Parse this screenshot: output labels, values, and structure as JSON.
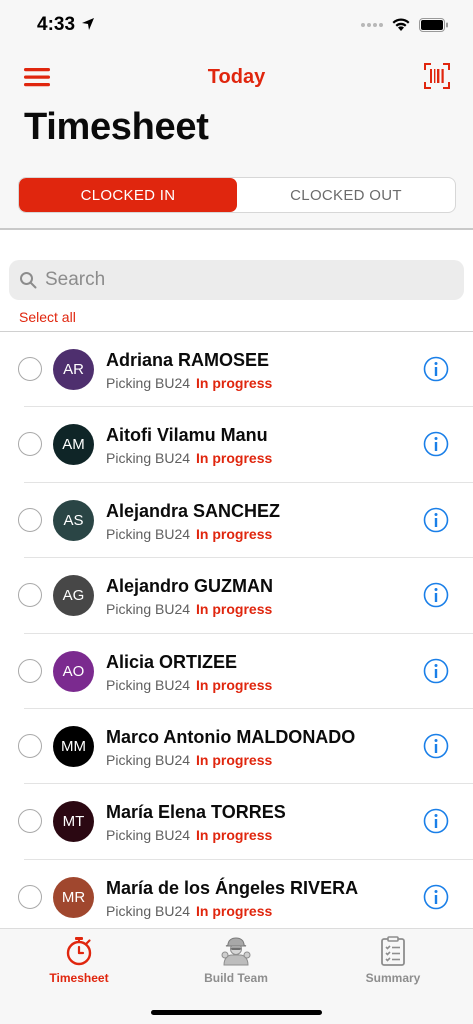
{
  "status_bar": {
    "time": "4:33"
  },
  "header": {
    "title": "Today",
    "page_title": "Timesheet"
  },
  "segments": [
    {
      "label": "CLOCKED IN",
      "active": true
    },
    {
      "label": "CLOCKED OUT",
      "active": false
    }
  ],
  "search": {
    "placeholder": "Search"
  },
  "select_all": "Select all",
  "colors": {
    "accent": "#e0260e",
    "info": "#1a7fe8"
  },
  "employees": [
    {
      "initials": "AR",
      "name": "Adriana RAMOSEE",
      "task": "Picking BU24",
      "status": "In progress",
      "avatar_color": "#4e2f6e"
    },
    {
      "initials": "AM",
      "name": "Aitofi Vilamu Manu",
      "task": "Picking BU24",
      "status": "In progress",
      "avatar_color": "#0f2527"
    },
    {
      "initials": "AS",
      "name": "Alejandra SANCHEZ",
      "task": "Picking BU24",
      "status": "In progress",
      "avatar_color": "#2a4545"
    },
    {
      "initials": "AG",
      "name": "Alejandro GUZMAN",
      "task": "Picking BU24",
      "status": "In progress",
      "avatar_color": "#474747"
    },
    {
      "initials": "AO",
      "name": "Alicia ORTIZEE",
      "task": "Picking BU24",
      "status": "In progress",
      "avatar_color": "#7b2a8f"
    },
    {
      "initials": "MM",
      "name": "Marco Antonio MALDONADO",
      "task": "Picking BU24",
      "status": "In progress",
      "avatar_color": "#000000"
    },
    {
      "initials": "MT",
      "name": "María Elena TORRES",
      "task": "Picking BU24",
      "status": "In progress",
      "avatar_color": "#2b0812"
    },
    {
      "initials": "MR",
      "name": "María de los Ángeles RIVERA",
      "task": "Picking BU24",
      "status": "In progress",
      "avatar_color": "#a0472e"
    }
  ],
  "tabs": [
    {
      "label": "Timesheet",
      "icon": "stopwatch-icon",
      "active": true
    },
    {
      "label": "Build Team",
      "icon": "workers-icon",
      "active": false
    },
    {
      "label": "Summary",
      "icon": "clipboard-checklist-icon",
      "active": false
    }
  ]
}
